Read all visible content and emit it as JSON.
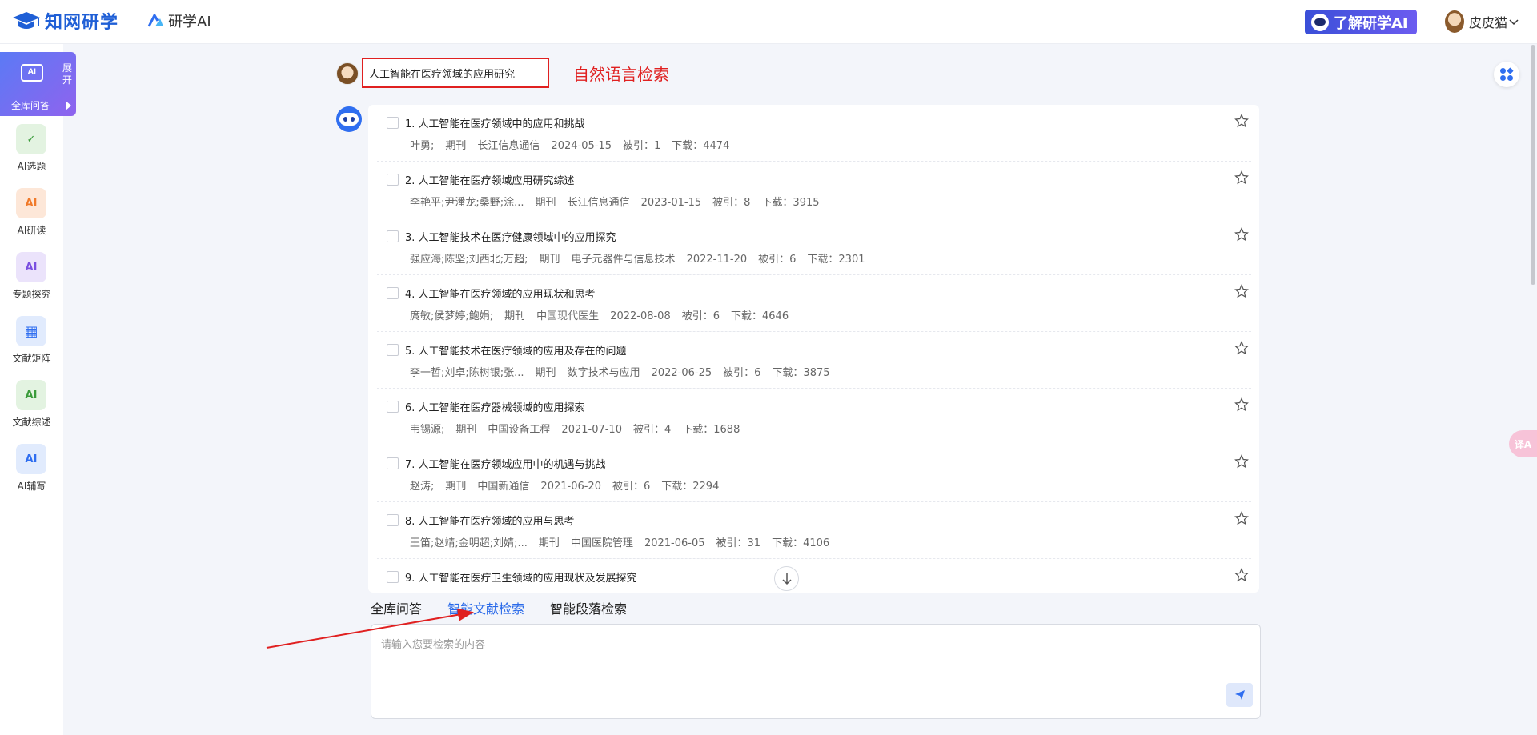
{
  "header": {
    "logo_text": "知网研学",
    "product_name": "研学AI",
    "learn_button": "了解研学AI",
    "username": "皮皮猫",
    "accent": "#1f5fd6"
  },
  "sidebar": {
    "active": {
      "icon_text": "AI",
      "label": "全库问答",
      "expand_label": "展开"
    },
    "items": [
      {
        "label": "AI选题",
        "icon_text": "✓"
      },
      {
        "label": "AI研读",
        "icon_text": "AI"
      },
      {
        "label": "专题探究",
        "icon_text": "AI"
      },
      {
        "label": "文献矩阵",
        "icon_text": "▦"
      },
      {
        "label": "文献综述",
        "icon_text": "AI"
      },
      {
        "label": "AI辅写",
        "icon_text": "AI"
      }
    ]
  },
  "query": {
    "text": "人工智能在医疗领域的应用研究",
    "annotation": "自然语言检索",
    "annotation_color": "#e02020"
  },
  "results": [
    {
      "title": "1. 人工智能在医疗领域中的应用和挑战",
      "authors": "叶勇;",
      "type": "期刊",
      "source": "长江信息通信",
      "date": "2024-05-15",
      "cited": "被引：1",
      "downloads": "下载：4474"
    },
    {
      "title": "2. 人工智能在医疗领域应用研究综述",
      "authors": "李艳平;尹潘龙;桑野;涂...",
      "type": "期刊",
      "source": "长江信息通信",
      "date": "2023-01-15",
      "cited": "被引：8",
      "downloads": "下载：3915"
    },
    {
      "title": "3. 人工智能技术在医疗健康领域中的应用探究",
      "authors": "强应海;陈坚;刘西北;万超;",
      "type": "期刊",
      "source": "电子元器件与信息技术",
      "date": "2022-11-20",
      "cited": "被引：6",
      "downloads": "下载：2301"
    },
    {
      "title": "4. 人工智能在医疗领域的应用现状和思考",
      "authors": "庹敏;侯梦婷;鲍娟;",
      "type": "期刊",
      "source": "中国现代医生",
      "date": "2022-08-08",
      "cited": "被引：6",
      "downloads": "下载：4646"
    },
    {
      "title": "5. 人工智能技术在医疗领域的应用及存在的问题",
      "authors": "李一哲;刘卓;陈树银;张...",
      "type": "期刊",
      "source": "数字技术与应用",
      "date": "2022-06-25",
      "cited": "被引：6",
      "downloads": "下载：3875"
    },
    {
      "title": "6. 人工智能在医疗器械领域的应用探索",
      "authors": "韦锡源;",
      "type": "期刊",
      "source": "中国设备工程",
      "date": "2021-07-10",
      "cited": "被引：4",
      "downloads": "下载：1688"
    },
    {
      "title": "7. 人工智能在医疗领域应用中的机遇与挑战",
      "authors": "赵涛;",
      "type": "期刊",
      "source": "中国新通信",
      "date": "2021-06-20",
      "cited": "被引：6",
      "downloads": "下载：2294"
    },
    {
      "title": "8. 人工智能在医疗领域的应用与思考",
      "authors": "王笛;赵靖;金明超;刘婧;...",
      "type": "期刊",
      "source": "中国医院管理",
      "date": "2021-06-05",
      "cited": "被引：31",
      "downloads": "下载：4106"
    },
    {
      "title": "9. 人工智能在医疗卫生领域的应用现状及发展探究",
      "authors": "",
      "type": "",
      "source": "",
      "date": "",
      "cited": "",
      "downloads": ""
    }
  ],
  "tabs": [
    {
      "label": "全库问答",
      "active": false
    },
    {
      "label": "智能文献检索",
      "active": true
    },
    {
      "label": "智能段落检索",
      "active": false
    }
  ],
  "input": {
    "placeholder": "请输入您要检索的内容"
  },
  "translate_badge": "译A"
}
